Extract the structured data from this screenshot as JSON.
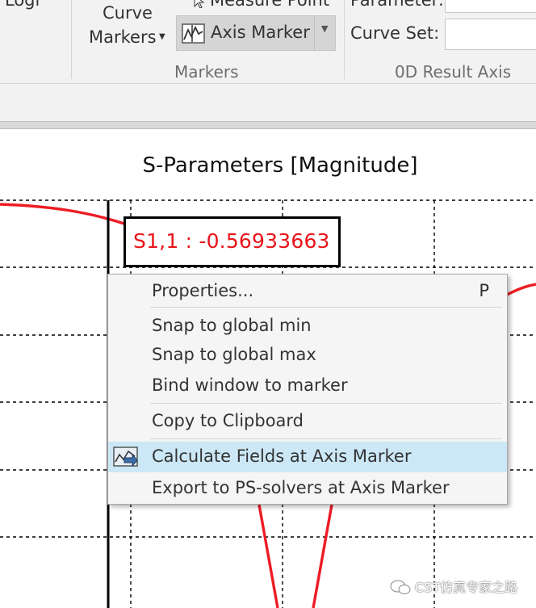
{
  "ribbon": {
    "partial_top_left": "Logi",
    "curve_markers_line1": "Curve",
    "curve_markers_line2": "Markers",
    "measure_point": "Measure Point",
    "axis_marker": "Axis Marker",
    "markers_group": "Markers",
    "parameter_label": "Parameter:",
    "curve_set_label": "Curve Set:",
    "result_axis_group": "0D Result Axis"
  },
  "plot": {
    "title": "S-Parameters [Magnitude]",
    "marker_readout": "S1,1 : -0.56933663",
    "curve_color": "#ee1c24"
  },
  "context_menu": {
    "items": [
      {
        "label": "Properties...",
        "shortcut": "P"
      },
      {
        "label": "Snap to global min"
      },
      {
        "label": "Snap to global max"
      },
      {
        "label": "Bind window to marker"
      },
      {
        "label": "Copy to Clipboard"
      },
      {
        "label": "Calculate Fields at Axis Marker",
        "highlighted": true,
        "icon": "calculate-fields-icon"
      },
      {
        "label": "Export to PS-solvers at Axis Marker"
      }
    ]
  },
  "watermark": "CST仿真专家之路"
}
